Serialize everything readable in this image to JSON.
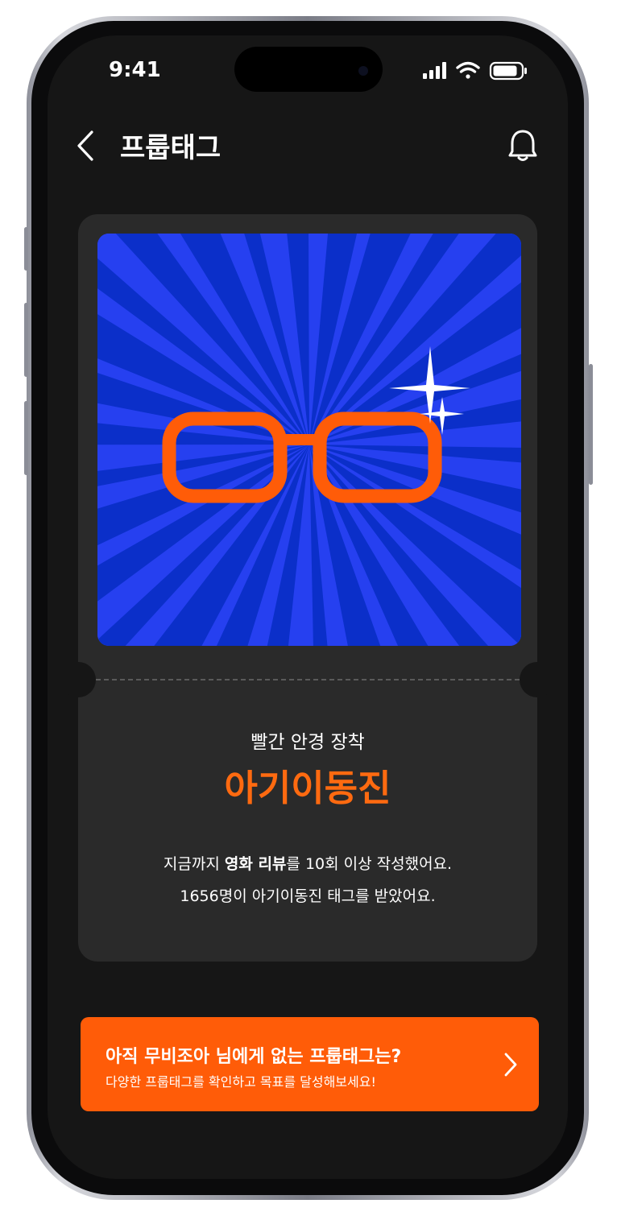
{
  "status_bar": {
    "time": "9:41"
  },
  "header": {
    "title": "프룹태그",
    "back_icon": "chevron-left-icon",
    "bell_icon": "bell-icon"
  },
  "tag_card": {
    "subtitle": "빨간 안경 장착",
    "tag_name": "아기이동진",
    "description_line1": {
      "prefix": "지금까지 ",
      "bold": "영화 리뷰",
      "suffix": "를 10회 이상 작성했어요."
    },
    "description_line2": "1656명이 아기이동진 태그를 받았어요.",
    "image_icon": "red-glasses-icon"
  },
  "cta": {
    "title": "아직 무비조아 님에게 없는 프룹태그는?",
    "subtitle": "다양한 프룹태그를 확인하고 목표를 달성해보세요!",
    "chevron_icon": "chevron-right-icon"
  },
  "colors": {
    "accent": "#ff5c08",
    "tag_name": "#ff6a10",
    "hero_bg": "#2640f0",
    "background": "#161616",
    "card": "#2a2a2a"
  }
}
